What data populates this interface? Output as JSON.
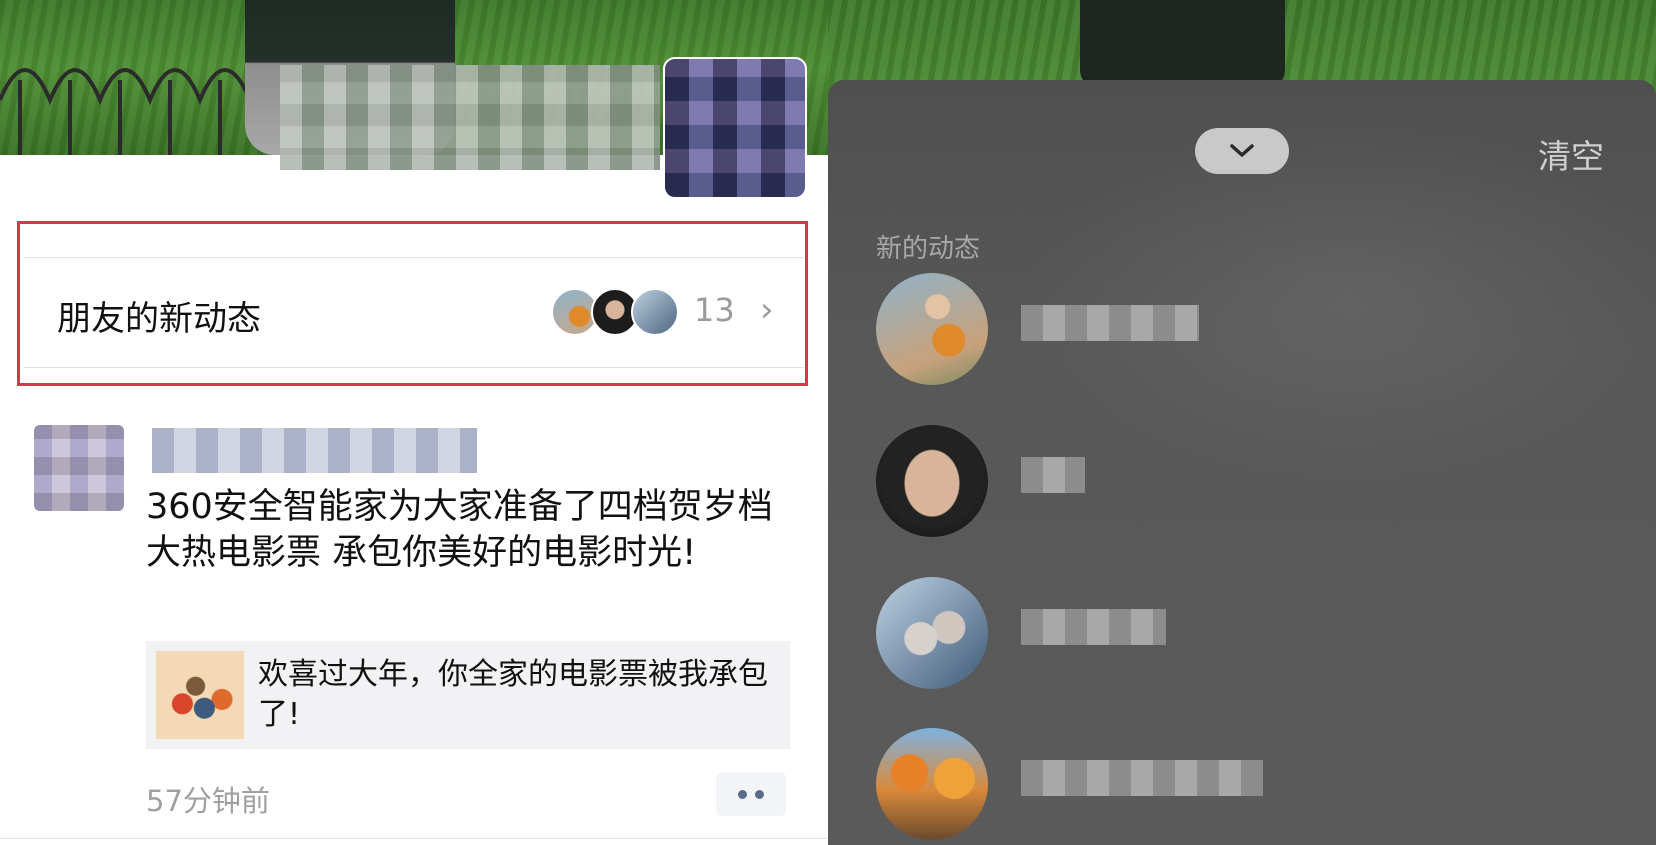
{
  "left": {
    "friends_updates": {
      "label": "朋友的新动态",
      "count": "13",
      "chevron": "›"
    },
    "post": {
      "text": "360安全智能家为大家准备了四档贺岁档大热电影票 承包你美好的电影时光!",
      "share_card_text": "欢喜过大年，你全家的电影票被我承包了!",
      "time": "57分钟前"
    }
  },
  "right": {
    "clear_label": "清空",
    "section_title": "新的动态",
    "collapse_icon": "chevron-down-icon"
  },
  "colors": {
    "highlight_border": "#e0334a",
    "sheet_bg": "#555555"
  }
}
